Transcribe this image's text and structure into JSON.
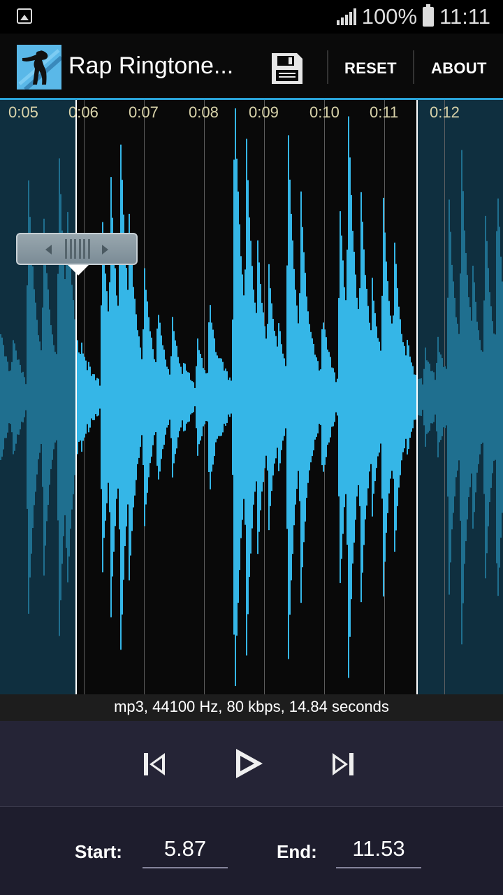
{
  "status_bar": {
    "battery_text": "100%",
    "time": "11:11",
    "left_icon": "gallery-icon"
  },
  "toolbar": {
    "title": "Rap Ringtone...",
    "save_icon": "save-icon",
    "reset_label": "RESET",
    "about_label": "ABOUT"
  },
  "waveform": {
    "tick_labels": [
      "0:05",
      "0:06",
      "0:07",
      "0:08",
      "0:09",
      "0:10",
      "0:11",
      "0:12"
    ],
    "selection_start_seconds": 5.87,
    "selection_end_seconds": 11.53,
    "accent_color": "#35b6e7",
    "dim_color": "#1f6f8f"
  },
  "file_info": "mp3, 44100 Hz, 80 kbps, 14.84 seconds",
  "player": {
    "previous_icon": "skip-previous-icon",
    "play_icon": "play-icon",
    "next_icon": "skip-next-icon"
  },
  "range": {
    "start_label": "Start:",
    "start_value": "5.87",
    "end_label": "End:",
    "end_value": "11.53"
  }
}
